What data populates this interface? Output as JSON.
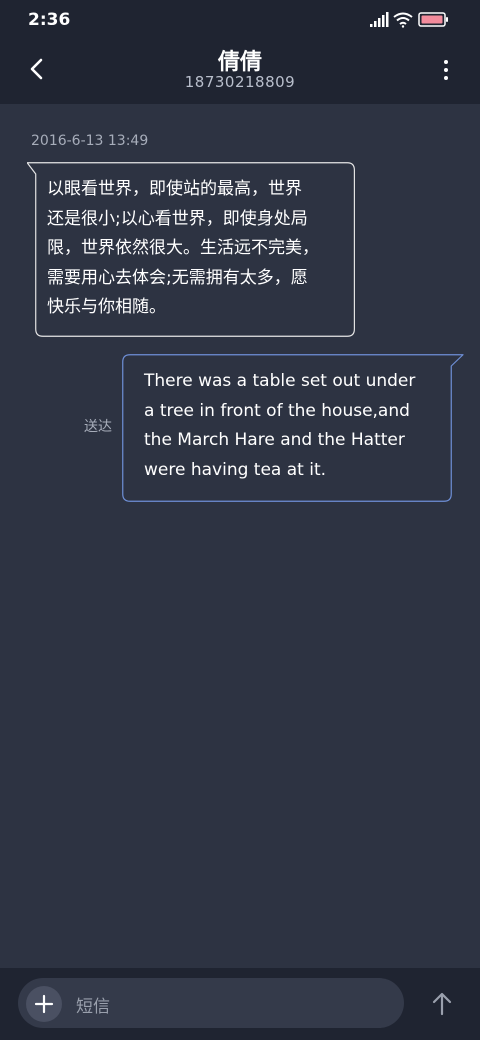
{
  "status_bar": {
    "time": "2:36",
    "icons": [
      "signal-icon",
      "wifi-icon",
      "battery-icon"
    ],
    "battery_color": "#f28b9c"
  },
  "header": {
    "back_icon": "chevron-left-icon",
    "title": "倩倩",
    "subtitle": "18730218809",
    "menu_icon": "more-vertical-icon"
  },
  "conversation": {
    "timestamp": "2016-6-13 13:49",
    "messages": [
      {
        "direction": "incoming",
        "text": "以眼看世界，即使站的最高，世界\n还是很小;以心看世界，即使身处局\n限，世界依然很大。生活远不完美，\n需要用心去体会;无需拥有太多，愿\n快乐与你相随。",
        "border_color": "#e6e6e6"
      },
      {
        "direction": "outgoing",
        "text": "There was a table set out under\na tree in front of the house,and\nthe March Hare and the Hatter\nwere having tea at it.",
        "status": "送达",
        "border_color": "#6e8fd6"
      }
    ]
  },
  "composer": {
    "attach_icon": "plus-icon",
    "placeholder": "短信",
    "send_icon": "arrow-up-icon"
  },
  "colors": {
    "background": "#2d3342",
    "bars": "#1f2431",
    "input": "#343a4a"
  }
}
